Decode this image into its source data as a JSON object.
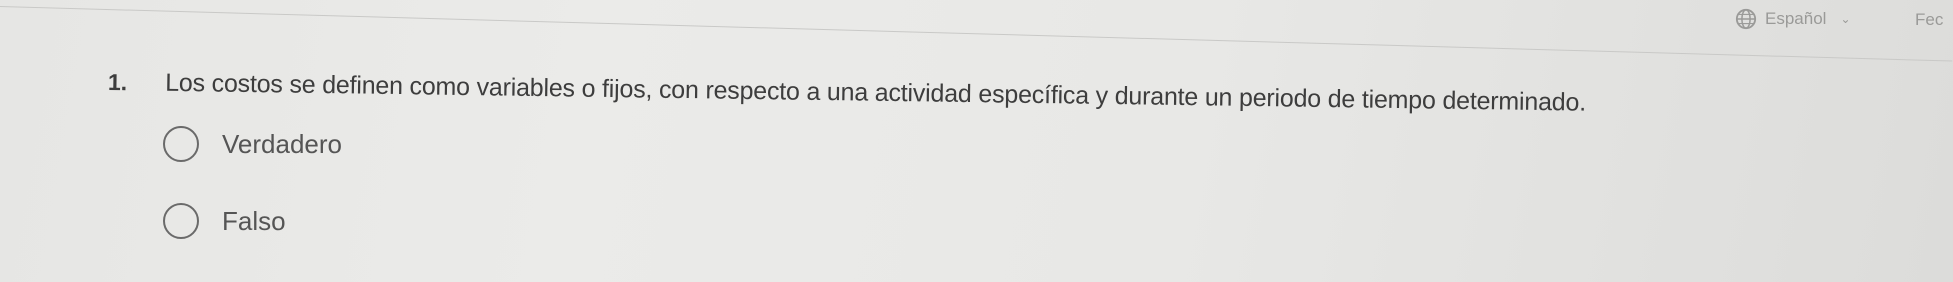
{
  "header": {
    "language": "Español",
    "language_icon": "globe-icon",
    "chevron_icon": "chevron-down-icon",
    "right_label": "Fec"
  },
  "question": {
    "number": "1.",
    "text": "Los costos se definen como variables o fijos, con respecto a una actividad específica y durante un periodo de tiempo determinado.",
    "options": [
      {
        "label": "Verdadero"
      },
      {
        "label": "Falso"
      }
    ]
  },
  "colors": {
    "background": "#e8e8e6",
    "text": "#3d3d3d",
    "radio_border": "#6a6a6a"
  }
}
